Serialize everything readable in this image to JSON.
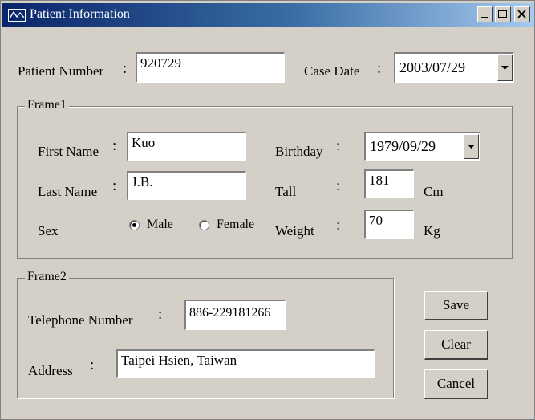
{
  "window": {
    "title": "Patient Information",
    "controls": {
      "minimize": "_",
      "maximize": "□",
      "close": "×"
    }
  },
  "top": {
    "patient_number_label": "Patient Number",
    "patient_number_value": "920729",
    "case_date_label": "Case Date",
    "case_date_value": "2003/07/29"
  },
  "frame1": {
    "title": "Frame1",
    "first_name_label": "First Name",
    "first_name_value": "Kuo",
    "last_name_label": "Last Name",
    "last_name_value": "J.B.",
    "sex_label": "Sex",
    "sex_options": [
      "Male",
      "Female"
    ],
    "sex_selected": "Male",
    "birthday_label": "Birthday",
    "birthday_value": "1979/09/29",
    "tall_label": "Tall",
    "tall_value": "181",
    "tall_unit": "Cm",
    "weight_label": "Weight",
    "weight_value": "70",
    "weight_unit": "Kg"
  },
  "frame2": {
    "title": "Frame2",
    "telephone_label": "Telephone Number",
    "telephone_value": "886-229181266",
    "address_label": "Address",
    "address_value": "Taipei Hsien, Taiwan"
  },
  "buttons": {
    "save": "Save",
    "clear": "Clear",
    "cancel": "Cancel"
  },
  "colon": ":",
  "colors": {
    "window_bg": "#d4d0c8",
    "titlebar_start": "#0a246a",
    "titlebar_end": "#a6caf0"
  }
}
